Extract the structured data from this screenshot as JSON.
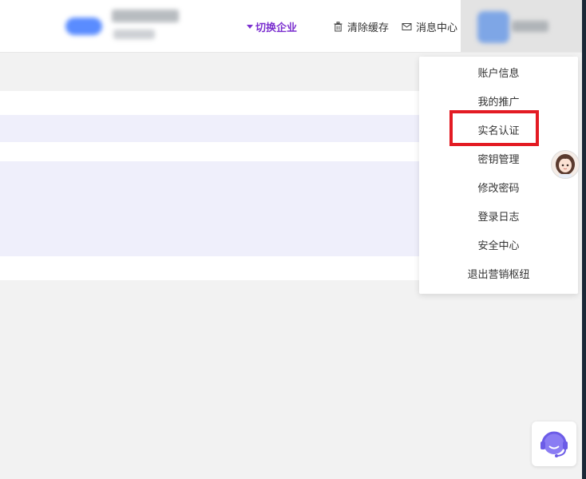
{
  "header": {
    "switch_company_label": "切换企业",
    "clear_cache_label": "清除缓存",
    "message_center_label": "消息中心"
  },
  "dropdown": {
    "items": [
      {
        "label": "账户信息"
      },
      {
        "label": "我的推广"
      },
      {
        "label": "实名认证"
      },
      {
        "label": "密钥管理"
      },
      {
        "label": "修改密码"
      },
      {
        "label": "登录日志"
      },
      {
        "label": "安全中心"
      },
      {
        "label": "退出营销枢纽"
      }
    ],
    "highlighted_index": 2
  },
  "colors": {
    "accent": "#7b2fcf",
    "highlight_border": "#e31b23",
    "row_alt": "#efeffb",
    "cs_icon": "#7a6cf0"
  },
  "icons": {
    "switch_caret": "caret-down-icon",
    "clear_cache": "trash-icon",
    "message_center": "mail-icon",
    "customer_service": "headset-icon"
  }
}
